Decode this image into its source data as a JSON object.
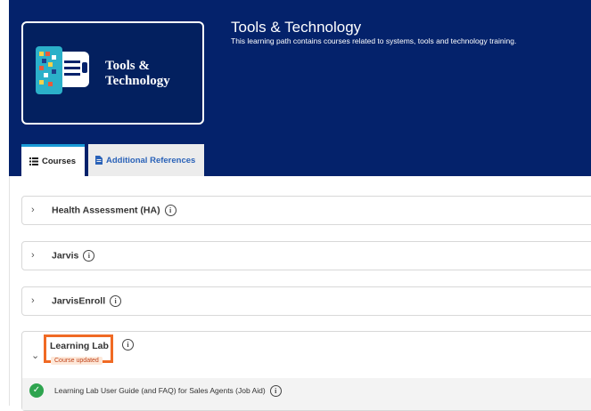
{
  "hero": {
    "thumb_text_line1": "Tools &",
    "thumb_text_line2": "Technology",
    "title": "Tools & Technology",
    "description": "This learning path contains courses related to systems, tools and technology training."
  },
  "tabs": [
    {
      "label": "Courses",
      "icon": "list-icon",
      "active": true
    },
    {
      "label": "Additional References",
      "icon": "document-icon",
      "active": false
    }
  ],
  "courses": [
    {
      "title": "Health Assessment (HA)",
      "expanded": false
    },
    {
      "title": "Jarvis",
      "expanded": false
    },
    {
      "title": "JarvisEnroll",
      "expanded": false
    },
    {
      "title": "Learning Lab",
      "expanded": true,
      "badge": "Course updated",
      "items": [
        {
          "title": "Learning Lab User Guide (and FAQ) for Sales Agents (Job Aid)",
          "status": "completed"
        }
      ]
    }
  ],
  "colors": {
    "hero_bg": "#04226b",
    "highlight": "#f06a24",
    "check": "#2ea44f",
    "tab_accent": "#1a9bd7",
    "link": "#2a62b8"
  },
  "info_glyph": "i"
}
